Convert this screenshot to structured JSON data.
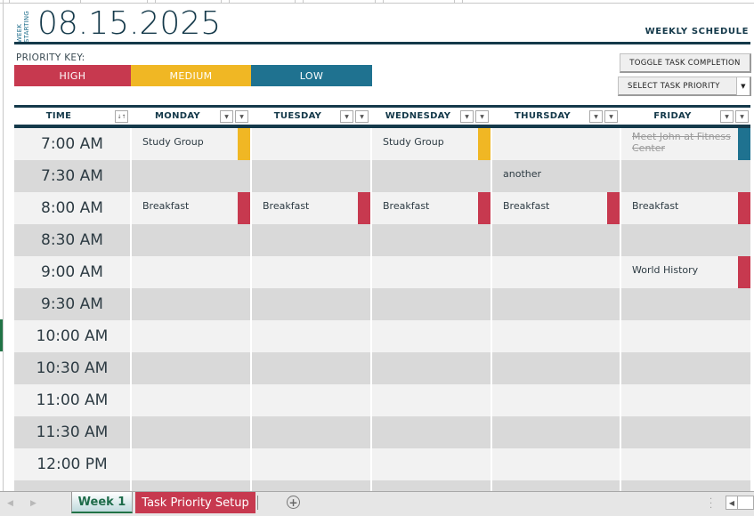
{
  "header": {
    "week_starting_line1": "WEEK",
    "week_starting_line2": "STARTING",
    "date": "08.15.2025",
    "title": "WEEKLY SCHEDULE"
  },
  "priority_key": {
    "label": "PRIORITY KEY:",
    "items": [
      {
        "label": "HIGH",
        "color": "#c7394f"
      },
      {
        "label": "MEDIUM",
        "color": "#f0b724"
      },
      {
        "label": "LOW",
        "color": "#1f7290"
      }
    ]
  },
  "controls": {
    "toggle_label": "TOGGLE TASK COMPLETION",
    "select_label": "SELECT TASK PRIORITY"
  },
  "table": {
    "columns": [
      "TIME",
      "MONDAY",
      "TUESDAY",
      "WEDNESDAY",
      "THURSDAY",
      "FRIDAY"
    ],
    "rows": [
      {
        "time": "7:00 AM",
        "tasks": [
          {
            "text": "Study Group",
            "priority": "medium"
          },
          {
            "text": "",
            "priority": ""
          },
          {
            "text": "Study Group",
            "priority": "medium"
          },
          {
            "text": "",
            "priority": ""
          },
          {
            "text": "Meet John at Fitness Center",
            "priority": "low",
            "done": true
          }
        ]
      },
      {
        "time": "7:30 AM",
        "tasks": [
          {
            "text": "",
            "priority": ""
          },
          {
            "text": "",
            "priority": ""
          },
          {
            "text": "",
            "priority": ""
          },
          {
            "text": "another",
            "priority": ""
          },
          {
            "text": "",
            "priority": ""
          }
        ]
      },
      {
        "time": "8:00 AM",
        "tasks": [
          {
            "text": "Breakfast",
            "priority": "high"
          },
          {
            "text": "Breakfast",
            "priority": "high"
          },
          {
            "text": "Breakfast",
            "priority": "high"
          },
          {
            "text": "Breakfast",
            "priority": "high"
          },
          {
            "text": "Breakfast",
            "priority": "high"
          }
        ]
      },
      {
        "time": "8:30 AM",
        "tasks": [
          {
            "text": ""
          },
          {
            "text": ""
          },
          {
            "text": ""
          },
          {
            "text": ""
          },
          {
            "text": ""
          }
        ]
      },
      {
        "time": "9:00 AM",
        "tasks": [
          {
            "text": "",
            "priority": ""
          },
          {
            "text": "",
            "priority": ""
          },
          {
            "text": "",
            "priority": ""
          },
          {
            "text": "",
            "priority": ""
          },
          {
            "text": "World History",
            "priority": "high"
          }
        ]
      },
      {
        "time": "9:30 AM",
        "tasks": [
          {
            "text": ""
          },
          {
            "text": ""
          },
          {
            "text": ""
          },
          {
            "text": ""
          },
          {
            "text": ""
          }
        ]
      },
      {
        "time": "10:00 AM",
        "tasks": [
          {
            "text": ""
          },
          {
            "text": ""
          },
          {
            "text": ""
          },
          {
            "text": ""
          },
          {
            "text": ""
          }
        ]
      },
      {
        "time": "10:30 AM",
        "tasks": [
          {
            "text": ""
          },
          {
            "text": ""
          },
          {
            "text": ""
          },
          {
            "text": ""
          },
          {
            "text": ""
          }
        ]
      },
      {
        "time": "11:00 AM",
        "tasks": [
          {
            "text": ""
          },
          {
            "text": ""
          },
          {
            "text": ""
          },
          {
            "text": ""
          },
          {
            "text": ""
          }
        ]
      },
      {
        "time": "11:30 AM",
        "tasks": [
          {
            "text": ""
          },
          {
            "text": ""
          },
          {
            "text": ""
          },
          {
            "text": ""
          },
          {
            "text": ""
          }
        ]
      },
      {
        "time": "12:00 PM",
        "tasks": [
          {
            "text": ""
          },
          {
            "text": ""
          },
          {
            "text": ""
          },
          {
            "text": ""
          },
          {
            "text": ""
          }
        ]
      },
      {
        "time": "",
        "tasks": [
          {
            "text": ""
          },
          {
            "text": ""
          },
          {
            "text": ""
          },
          {
            "text": ""
          },
          {
            "text": ""
          }
        ]
      }
    ]
  },
  "colors": {
    "high": "#c7394f",
    "medium": "#f0b724",
    "low": "#1f7290",
    "row_light": "#f2f2f2",
    "row_dark": "#d9d9d9",
    "dark_navy": "#14394a"
  },
  "sheet_tabs": [
    {
      "label": "Week 1",
      "active": true
    },
    {
      "label": "Task Priority Setup",
      "active": false
    }
  ],
  "icons": {
    "sort_filter": "sort-filter-icon",
    "filter_dropdown": "filter-dropdown-icon",
    "add_sheet": "plus-circle-icon"
  }
}
